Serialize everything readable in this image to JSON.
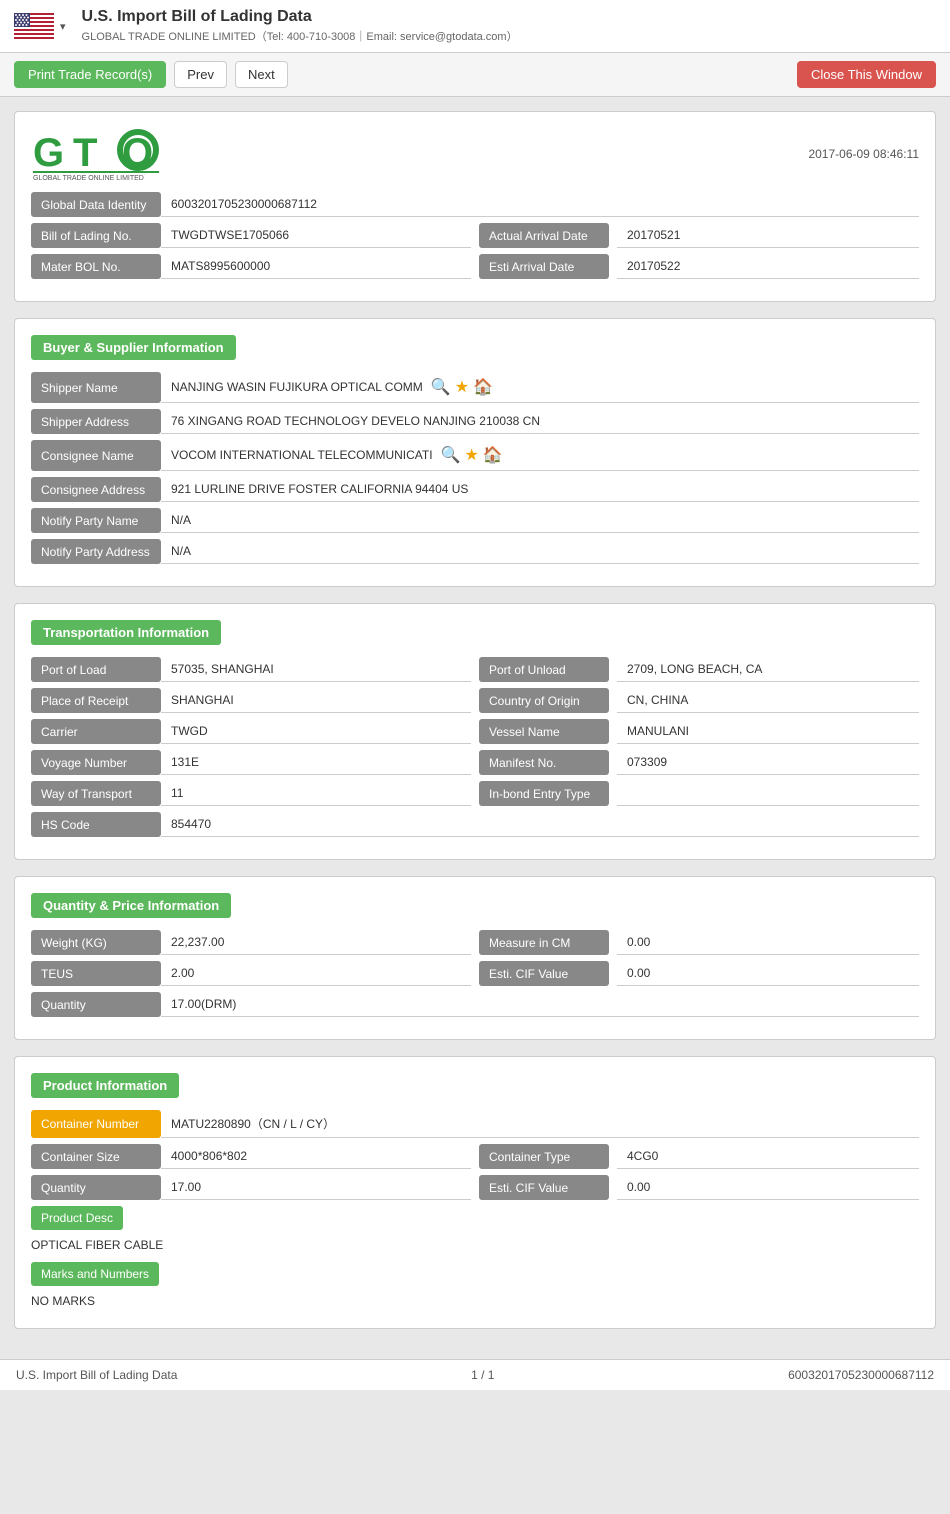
{
  "topbar": {
    "title": "U.S. Import Bill of Lading Data",
    "subtitle": "GLOBAL TRADE ONLINE LIMITED（Tel: 400-710-3008｜Email: service@gtodata.com）",
    "dropdown_icon": "▾"
  },
  "toolbar": {
    "print_label": "Print Trade Record(s)",
    "prev_label": "Prev",
    "next_label": "Next",
    "close_label": "Close This Window"
  },
  "logo": {
    "name": "GTO",
    "full": "GLOBAL TRADE ONLINE LIMITED",
    "timestamp": "2017-06-09 08:46:11"
  },
  "identity": {
    "global_data_identity_label": "Global Data Identity",
    "global_data_identity_value": "6003201705230000687112",
    "bol_label": "Bill of Lading No.",
    "bol_value": "TWGDTWSE1705066",
    "actual_arrival_label": "Actual Arrival Date",
    "actual_arrival_value": "20170521",
    "master_bol_label": "Mater BOL No.",
    "master_bol_value": "MATS8995600000",
    "esti_arrival_label": "Esti Arrival Date",
    "esti_arrival_value": "20170522"
  },
  "buyer_supplier": {
    "section_title": "Buyer & Supplier Information",
    "shipper_name_label": "Shipper Name",
    "shipper_name_value": "NANJING WASIN FUJIKURA OPTICAL COMM",
    "shipper_address_label": "Shipper Address",
    "shipper_address_value": "76 XINGANG ROAD TECHNOLOGY DEVELO NANJING 210038 CN",
    "consignee_name_label": "Consignee Name",
    "consignee_name_value": "VOCOM INTERNATIONAL TELECOMMUNICATI",
    "consignee_address_label": "Consignee Address",
    "consignee_address_value": "921 LURLINE DRIVE FOSTER CALIFORNIA 94404 US",
    "notify_party_name_label": "Notify Party Name",
    "notify_party_name_value": "N/A",
    "notify_party_address_label": "Notify Party Address",
    "notify_party_address_value": "N/A"
  },
  "transportation": {
    "section_title": "Transportation Information",
    "port_of_load_label": "Port of Load",
    "port_of_load_value": "57035, SHANGHAI",
    "port_of_unload_label": "Port of Unload",
    "port_of_unload_value": "2709, LONG BEACH, CA",
    "place_of_receipt_label": "Place of Receipt",
    "place_of_receipt_value": "SHANGHAI",
    "country_of_origin_label": "Country of Origin",
    "country_of_origin_value": "CN, CHINA",
    "carrier_label": "Carrier",
    "carrier_value": "TWGD",
    "vessel_name_label": "Vessel Name",
    "vessel_name_value": "MANULANI",
    "voyage_number_label": "Voyage Number",
    "voyage_number_value": "131E",
    "manifest_no_label": "Manifest No.",
    "manifest_no_value": "073309",
    "way_of_transport_label": "Way of Transport",
    "way_of_transport_value": "11",
    "inbond_label": "In-bond Entry Type",
    "inbond_value": "",
    "hs_code_label": "HS Code",
    "hs_code_value": "854470"
  },
  "quantity_price": {
    "section_title": "Quantity & Price Information",
    "weight_label": "Weight (KG)",
    "weight_value": "22,237.00",
    "measure_label": "Measure in CM",
    "measure_value": "0.00",
    "teus_label": "TEUS",
    "teus_value": "2.00",
    "esti_cif_label": "Esti. CIF Value",
    "esti_cif_value": "0.00",
    "quantity_label": "Quantity",
    "quantity_value": "17.00(DRM)"
  },
  "product": {
    "section_title": "Product Information",
    "container_number_label": "Container Number",
    "container_number_value": "MATU2280890（CN / L / CY）",
    "container_size_label": "Container Size",
    "container_size_value": "4000*806*802",
    "container_type_label": "Container Type",
    "container_type_value": "4CG0",
    "quantity_label": "Quantity",
    "quantity_value": "17.00",
    "esti_cif_label": "Esti. CIF Value",
    "esti_cif_value": "0.00",
    "product_desc_label": "Product Desc",
    "product_desc_value": "OPTICAL FIBER CABLE",
    "marks_label": "Marks and Numbers",
    "marks_value": "NO MARKS"
  },
  "footer": {
    "left": "U.S. Import Bill of Lading Data",
    "center": "1 / 1",
    "right": "6003201705230000687112"
  }
}
